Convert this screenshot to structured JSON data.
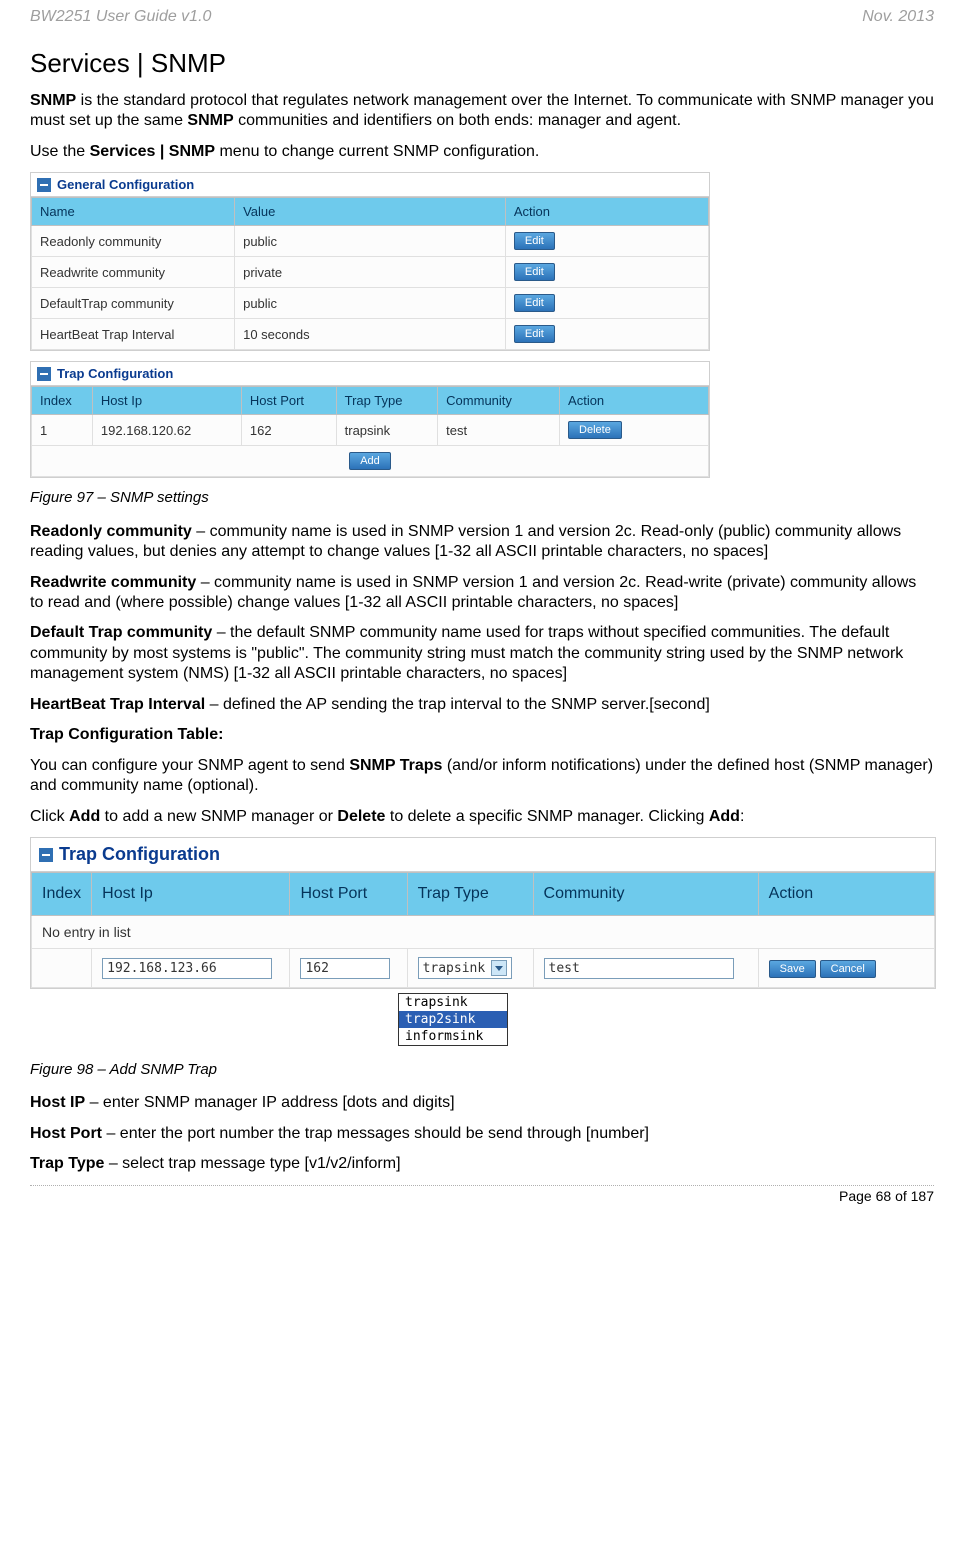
{
  "header": {
    "left": "BW2251 User Guide v1.0",
    "right": "Nov.  2013"
  },
  "title": "Services | SNMP",
  "intro": {
    "p1a": "SNMP",
    "p1b": " is the standard protocol that regulates network management over the Internet. To communicate with SNMP manager you must set up the same ",
    "p1c": "SNMP",
    "p1d": " communities and identifiers on both ends: manager and agent.",
    "p2a": "Use the ",
    "p2b": "Services | SNMP",
    "p2c": " menu to change current SNMP configuration."
  },
  "general": {
    "title": "General Configuration",
    "cols": {
      "name": "Name",
      "value": "Value",
      "action": "Action"
    },
    "rows": [
      {
        "name": "Readonly community",
        "value": "public",
        "action": "Edit"
      },
      {
        "name": "Readwrite community",
        "value": "private",
        "action": "Edit"
      },
      {
        "name": "DefaultTrap community",
        "value": "public",
        "action": "Edit"
      },
      {
        "name": "HeartBeat Trap Interval",
        "value": "10 seconds",
        "action": "Edit"
      }
    ]
  },
  "trap1": {
    "title": "Trap Configuration",
    "cols": {
      "index": "Index",
      "host": "Host Ip",
      "port": "Host Port",
      "type": "Trap Type",
      "comm": "Community",
      "action": "Action"
    },
    "rows": [
      {
        "index": "1",
        "host": "192.168.120.62",
        "port": "162",
        "type": "trapsink",
        "comm": "test",
        "action": "Delete"
      }
    ],
    "add": "Add"
  },
  "fig1": "Figure 97 – SNMP settings",
  "defs": {
    "readonly_b": "Readonly community",
    "readonly_t": " – community name is used in SNMP version 1 and version 2c. Read-only (public) community allows reading values, but denies any attempt to change values [1-32 all ASCII printable characters, no spaces]",
    "readwrite_b": "Readwrite community",
    "readwrite_t": " – community name is used in SNMP version 1 and version 2c. Read-write (private) community allows to read and (where possible) change values [1-32 all ASCII printable characters, no spaces]",
    "deftrap_b": "Default Trap community",
    "deftrap_t": " – the default SNMP community name used for traps without specified communities. The default community by most systems is \"public\". The community string must match the community string used by the SNMP network management system (NMS) [1-32 all ASCII printable characters, no spaces]",
    "hb_b": "HeartBeat Trap Interval ",
    "hb_t": " – defined the AP sending the trap interval to the SNMP server.[second]",
    "tct_b": "Trap Configuration Table:",
    "p_you_a": "You can configure your SNMP agent to send ",
    "p_you_b": "SNMP Traps",
    "p_you_c": " (and/or inform notifications) under the defined host (SNMP manager) and community name (optional).",
    "p_click_a": "Click ",
    "p_click_b": "Add",
    "p_click_c": " to add a new SNMP manager or ",
    "p_click_d": "Delete",
    "p_click_e": " to delete a specific SNMP manager. Clicking ",
    "p_click_f": "Add",
    "p_click_g": ":"
  },
  "trap2": {
    "title": "Trap Configuration",
    "cols": {
      "index": "Index",
      "host": "Host Ip",
      "port": "Host Port",
      "type": "Trap Type",
      "comm": "Community",
      "action": "Action"
    },
    "noentry": "No entry in list",
    "input": {
      "host": "192.168.123.66",
      "port": "162",
      "type": "trapsink",
      "comm": "test"
    },
    "save": "Save",
    "cancel": "Cancel",
    "options": {
      "o1": "trapsink",
      "o2": "trap2sink",
      "o3": "informsink"
    }
  },
  "fig2": "Figure 98 – Add SNMP Trap",
  "defs2": {
    "hostip_b": "Host IP",
    "hostip_t": " – enter SNMP manager IP address [dots and digits]",
    "hostport_b": "Host Port",
    "hostport_t": " – enter the port number the trap messages should be send through [number]",
    "traptype_b": "Trap Type",
    "traptype_t": " – select trap message type [v1/v2/inform]"
  },
  "footer": "Page 68 of 187"
}
